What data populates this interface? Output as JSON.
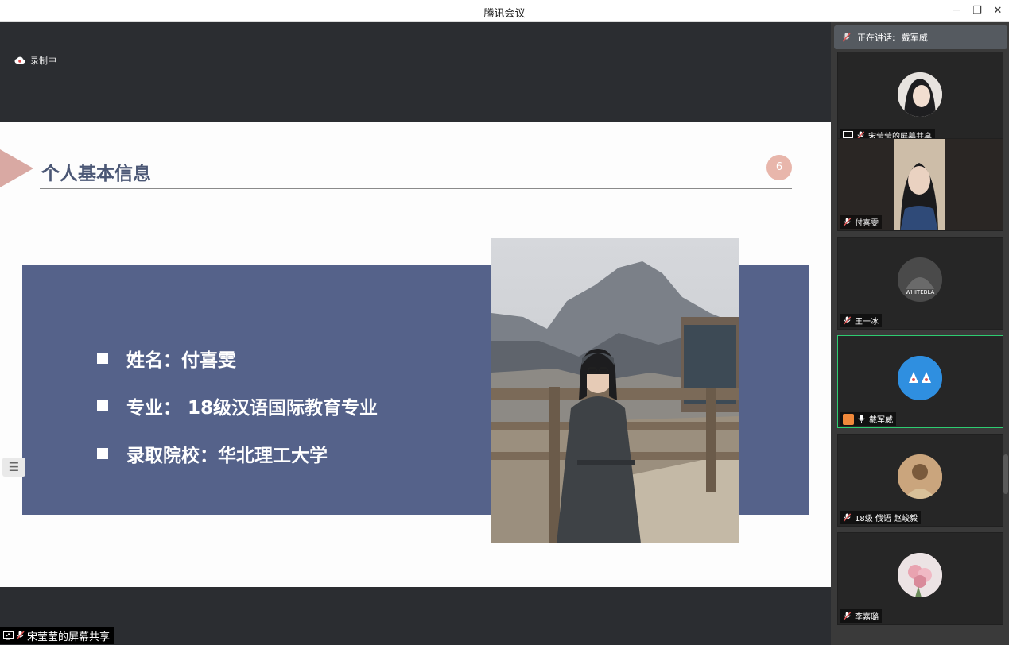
{
  "window": {
    "title": "腾讯会议",
    "minimize_glyph": "─",
    "restore_glyph": "❐",
    "close_glyph": "✕"
  },
  "recording": {
    "label": "录制中",
    "icon": "cloud-recording-icon"
  },
  "slide": {
    "title": "个人基本信息",
    "page_number": "6",
    "info_items": [
      "姓名：付喜雯",
      "专业： 18级汉语国际教育专业",
      "录取院校：华北理工大学"
    ],
    "list_button_glyph": "☰"
  },
  "share_bar": {
    "label": "宋莹莹的屏幕共享",
    "icons": [
      "screen-share-icon",
      "mic-muted-icon"
    ]
  },
  "sidebar": {
    "speaking_label": "正在讲话:",
    "speaking_name": "戴军威",
    "participants": [
      {
        "name": "宋莹莹的屏幕共享",
        "icon": "screen-share-icon",
        "muted": true,
        "active": false
      },
      {
        "name": "付喜雯",
        "muted": true,
        "active": false
      },
      {
        "name": "王一冰",
        "muted": true,
        "active": false,
        "avatar_text": "WHITEBLA"
      },
      {
        "name": "戴军威",
        "muted": false,
        "active": true,
        "host_badge": true
      },
      {
        "name": "18级 俄语 赵峻毅",
        "muted": true,
        "active": false
      },
      {
        "name": "李嘉璐",
        "muted": true,
        "active": false
      }
    ]
  },
  "colors": {
    "slide_band": "#55628a",
    "accent_pink": "#d9a9a3",
    "active_border": "#2ecc71",
    "mic_muted": "#e05555"
  }
}
